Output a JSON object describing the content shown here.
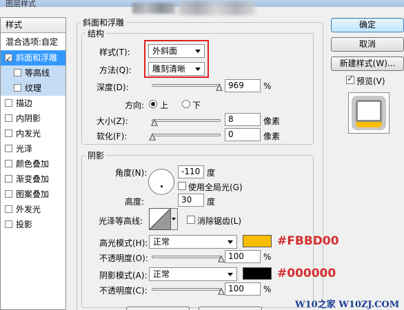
{
  "window": {
    "title": "图层样式"
  },
  "sidebar": {
    "header": "样式",
    "blend_options": "混合选项:自定",
    "items": [
      {
        "label": "斜面和浮雕",
        "checked": true
      },
      {
        "label": "等高线",
        "checked": false
      },
      {
        "label": "纹理",
        "checked": false
      },
      {
        "label": "描边",
        "checked": false
      },
      {
        "label": "内阴影",
        "checked": false
      },
      {
        "label": "内发光",
        "checked": false
      },
      {
        "label": "光泽",
        "checked": false
      },
      {
        "label": "颜色叠加",
        "checked": false
      },
      {
        "label": "渐变叠加",
        "checked": false
      },
      {
        "label": "图案叠加",
        "checked": false
      },
      {
        "label": "外发光",
        "checked": false
      },
      {
        "label": "投影",
        "checked": false
      }
    ]
  },
  "bevel": {
    "panel_title": "斜面和浮雕",
    "structure_title": "结构",
    "style_label": "样式(T):",
    "style_value": "外斜面",
    "technique_label": "方法(Q):",
    "technique_value": "雕刻清晰",
    "depth_label": "深度(D):",
    "depth_value": "969",
    "depth_unit": "%",
    "direction_label": "方向:",
    "direction_up": "上",
    "direction_down": "下",
    "size_label": "大小(Z):",
    "size_value": "8",
    "size_unit": "像素",
    "soften_label": "软化(F):",
    "soften_value": "0",
    "soften_unit": "像素",
    "depth_level": 0.97,
    "size_level": 0.03,
    "soften_level": 0.0
  },
  "shading": {
    "title": "阴影",
    "angle_label": "角度(N):",
    "angle_value": "-110",
    "angle_unit": "度",
    "global_light_label": "使用全局光(G)",
    "global_light_checked": false,
    "altitude_label": "高度:",
    "altitude_value": "30",
    "altitude_unit": "度",
    "gloss_contour_label": "光泽等高线:",
    "anti_alias_label": "消除锯齿(L)",
    "anti_alias_checked": false,
    "highlight_mode_label": "高光模式(H):",
    "highlight_mode_value": "正常",
    "highlight_color": "#FBBD00",
    "highlight_opacity_label": "不透明度(O):",
    "highlight_opacity_value": "100",
    "highlight_opacity_level": 1.0,
    "shadow_mode_label": "阴影模式(A):",
    "shadow_mode_value": "正常",
    "shadow_color": "#000000",
    "shadow_opacity_label": "不透明度(C):",
    "shadow_opacity_value": "100",
    "shadow_opacity_level": 1.0,
    "percent": "%"
  },
  "annotations": {
    "highlight_hex": "#FBBD00",
    "shadow_hex": "#000000"
  },
  "buttons": {
    "ok": "确定",
    "cancel": "取消",
    "new_style": "新建样式(W)...",
    "preview_label": "预览(V)",
    "preview_checked": true
  },
  "watermark": {
    "text": "W10之家 W10ZJ.COM"
  }
}
